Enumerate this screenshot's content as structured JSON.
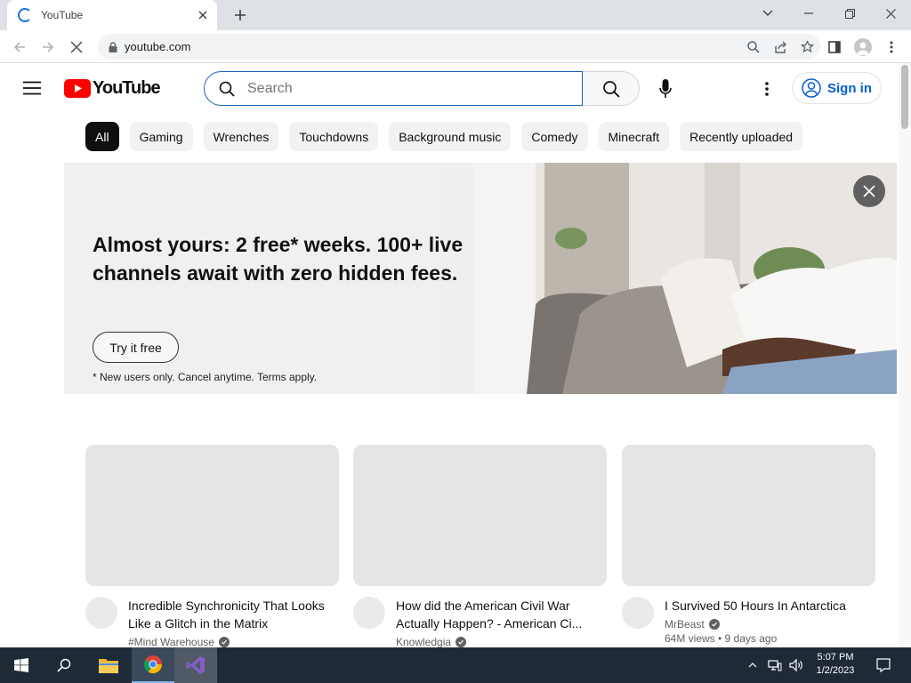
{
  "browser": {
    "tab_title": "YouTube",
    "url": "youtube.com"
  },
  "youtube": {
    "logo_text": "YouTube",
    "search_placeholder": "Search",
    "signin_label": "Sign in",
    "chips": [
      "All",
      "Gaming",
      "Wrenches",
      "Touchdowns",
      "Background music",
      "Comedy",
      "Minecraft",
      "Recently uploaded"
    ],
    "active_chip": "All",
    "brand_red": "#ff0000"
  },
  "ad": {
    "headline": "Almost yours: 2 free* weeks. 100+ live channels await with zero hidden fees.",
    "cta": "Try it free",
    "fine_print": "* New users only. Cancel anytime. Terms apply."
  },
  "videos": [
    {
      "title": "Incredible Synchronicity That Looks Like a Glitch in the Matrix",
      "channel": "#Mind Warehouse",
      "meta": ""
    },
    {
      "title": "How did the American Civil War Actually Happen? - American Ci...",
      "channel": "Knowledgia",
      "meta": ""
    },
    {
      "title": "I Survived 50 Hours In Antarctica",
      "channel": "MrBeast",
      "meta": "64M views • 9 days ago"
    }
  ],
  "taskbar": {
    "time": "5:07 PM",
    "date": "1/2/2023",
    "apps": [
      "windows-start",
      "search",
      "file-explorer",
      "chrome",
      "visual-studio"
    ]
  }
}
